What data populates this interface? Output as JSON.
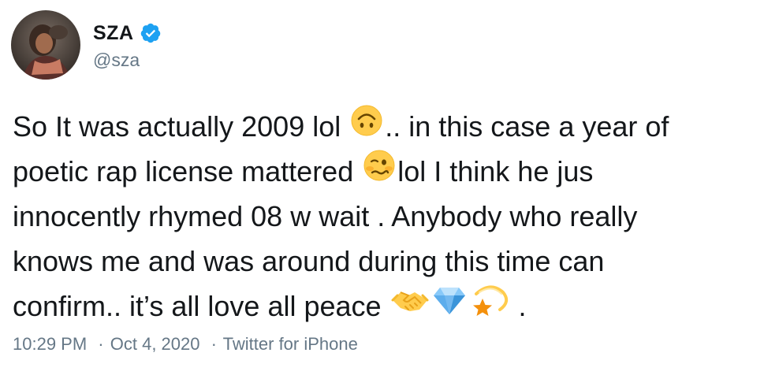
{
  "author": {
    "display_name": "SZA",
    "handle": "@sza",
    "verified": true
  },
  "tweet": {
    "lines": [
      {
        "before": "So It was actually 2009 lol ",
        "after": ".. in this case a year of"
      },
      {
        "before": "poetic rap license mattered ",
        "after": "lol I think he jus"
      },
      {
        "text": "innocently rhymed 08 w wait . Anybody who really"
      },
      {
        "text": "knows me and was around during this time can"
      },
      {
        "before": "confirm.. it’s all love all peace ",
        "after": " ."
      }
    ],
    "emojis": [
      "upside-down-face-emoji",
      "woozy-face-emoji",
      "handshake-emoji",
      "gem-emoji",
      "dizzy-star-emoji"
    ]
  },
  "meta": {
    "time": "10:29 PM",
    "date": "Oct 4, 2020",
    "source": "Twitter for iPhone",
    "separator": "·"
  },
  "colors": {
    "text": "#14171a",
    "secondary": "#657786",
    "verified_blue": "#1da1f2"
  }
}
